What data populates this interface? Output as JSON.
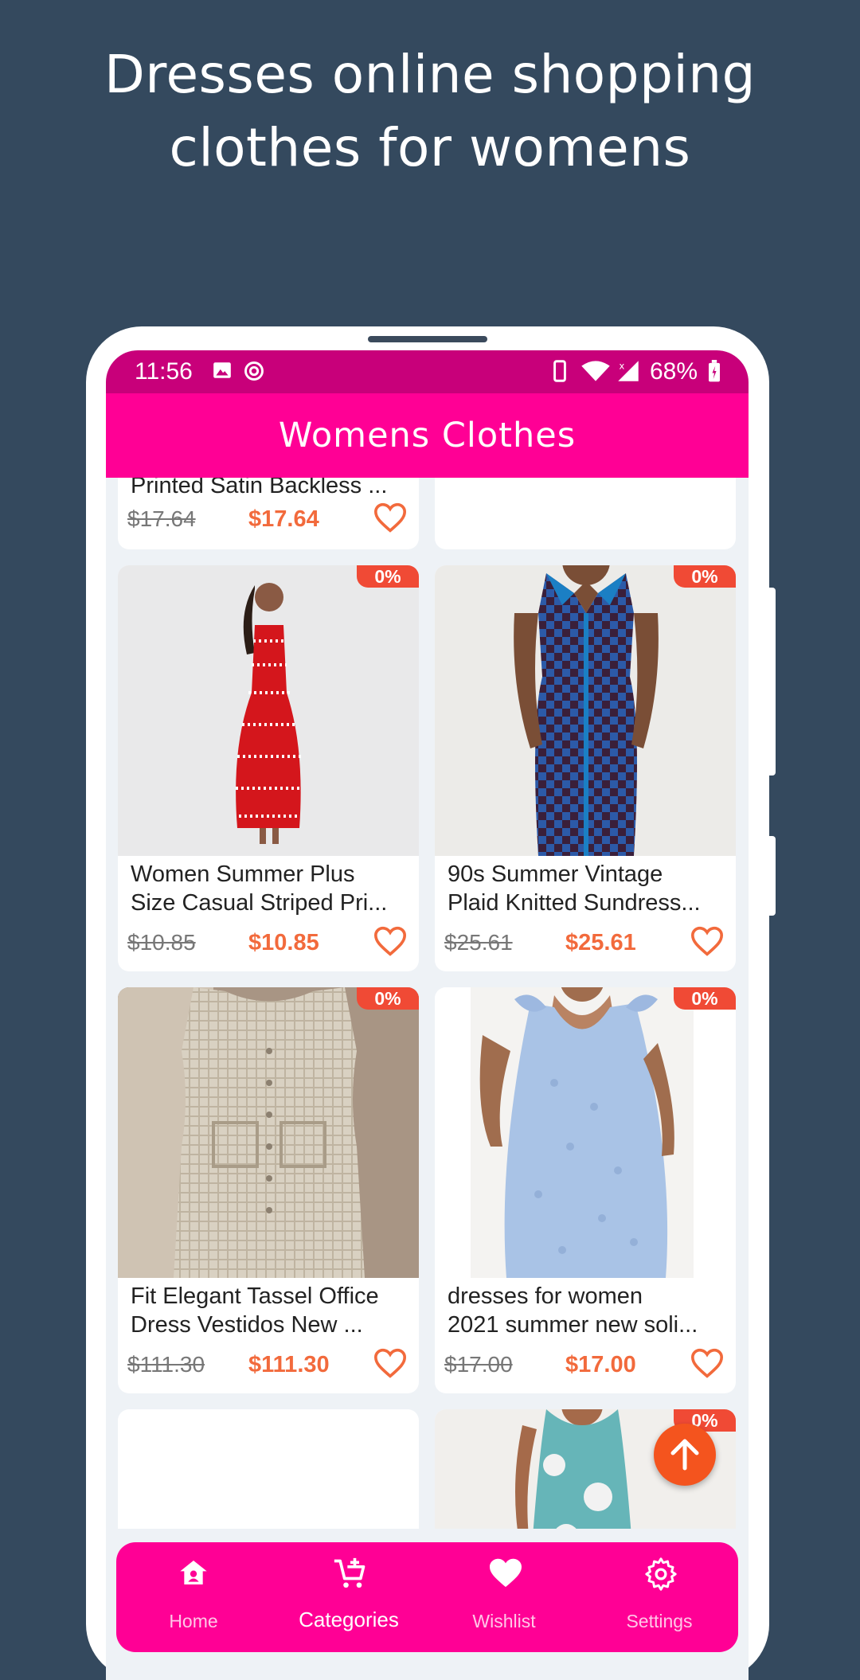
{
  "promo": {
    "line1": "Dresses online shopping",
    "line2": "clothes for womens"
  },
  "status": {
    "time": "11:56",
    "battery": "68%"
  },
  "appbar": {
    "title": "Womens Clothes"
  },
  "colors": {
    "background": "#34495e",
    "appbar": "#ff0095",
    "statusbar": "#c8007a",
    "price": "#f26a3c",
    "badge": "#f04a35",
    "fab": "#f4541e"
  },
  "products": [
    {
      "name": "Printed Satin Backless ...",
      "old_price": "$17.64",
      "price": "$17.64"
    },
    {
      "name": "",
      "old_price": "",
      "price": ""
    },
    {
      "name_line1": "Women Summer Plus",
      "name_line2": "Size Casual Striped Pri...",
      "old_price": "$10.85",
      "price": "$10.85",
      "discount": "0%"
    },
    {
      "name_line1": "90s Summer Vintage",
      "name_line2": "Plaid Knitted Sundress...",
      "old_price": "$25.61",
      "price": "$25.61",
      "discount": "0%"
    },
    {
      "name_line1": "Fit Elegant Tassel Office",
      "name_line2": "Dress Vestidos New ...",
      "old_price": "$111.30",
      "price": "$111.30",
      "discount": "0%"
    },
    {
      "name_line1": "dresses for women",
      "name_line2": "2021 summer new soli...",
      "old_price": "$17.00",
      "price": "$17.00",
      "discount": "0%"
    },
    {
      "discount": "0%"
    }
  ],
  "nav": [
    {
      "label": "Home",
      "icon": "home-icon"
    },
    {
      "label": "Categories",
      "icon": "cart-add-icon"
    },
    {
      "label": "Wishlist",
      "icon": "heart-icon"
    },
    {
      "label": "Settings",
      "icon": "gear-icon"
    }
  ]
}
